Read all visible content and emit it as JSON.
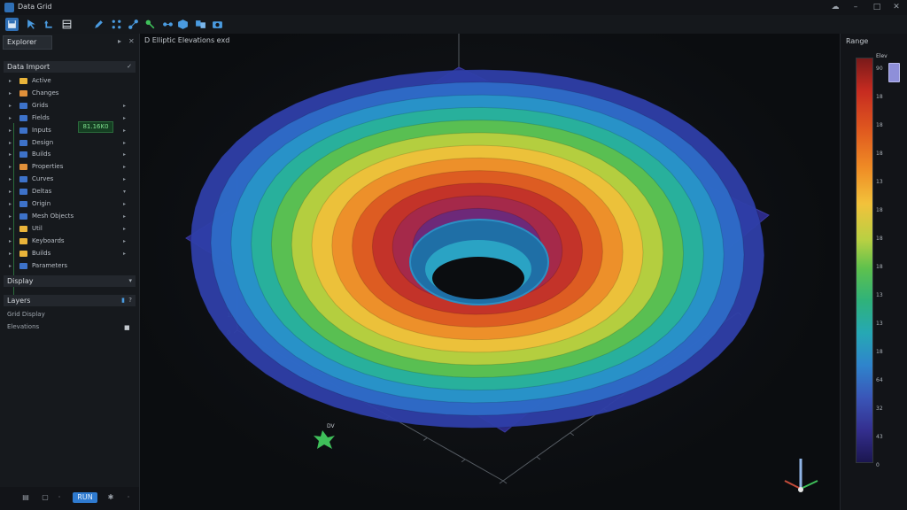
{
  "window": {
    "title": "Data Grid"
  },
  "toolbar": {
    "icons": [
      "save-icon",
      "cursor-icon",
      "undo-icon",
      "layers-icon",
      "pen-icon",
      "grid-icon",
      "magic-icon",
      "node-icon",
      "cube-icon",
      "compare-icon",
      "camera-icon"
    ]
  },
  "left": {
    "tab_label": "Explorer",
    "section_import": "Data Import",
    "items": [
      {
        "label": "Active",
        "color": "#e9b43a",
        "arrow": ""
      },
      {
        "label": "Changes",
        "color": "#e0903a",
        "arrow": ""
      },
      {
        "label": "Grids",
        "color": "#3d72c9",
        "arrow": "▸"
      },
      {
        "label": "Fields",
        "color": "#3d72c9",
        "arrow": "▸"
      },
      {
        "label": "Inputs",
        "color": "#3d72c9",
        "arrow": "▸"
      },
      {
        "label": "Design",
        "color": "#3d72c9",
        "arrow": "▸"
      },
      {
        "label": "Builds",
        "color": "#3d72c9",
        "arrow": "▸"
      },
      {
        "label": "Properties",
        "color": "#e0903a",
        "arrow": "▸"
      },
      {
        "label": "Curves",
        "color": "#3d72c9",
        "arrow": "▸"
      },
      {
        "label": "Deltas",
        "color": "#3d72c9",
        "arrow": "▾"
      },
      {
        "label": "Origin",
        "color": "#3d72c9",
        "arrow": "▸"
      },
      {
        "label": "Mesh Objects",
        "color": "#3d72c9",
        "arrow": "▸"
      },
      {
        "label": "Util",
        "color": "#e9b43a",
        "arrow": "▸"
      },
      {
        "label": "Keyboards",
        "color": "#e9b43a",
        "arrow": "▸"
      },
      {
        "label": "Builds",
        "color": "#e9b43a",
        "arrow": "▸"
      },
      {
        "label": "Parameters",
        "color": "#3d72c9",
        "arrow": ""
      }
    ],
    "value_badge": "81.16K0",
    "section_display": "Display",
    "section_layers": "Layers",
    "prop_rows": [
      "Grid Display",
      "Elevations"
    ],
    "bottom_buttons": [
      "list-icon",
      "file-icon",
      "run",
      "pin-icon"
    ],
    "run_label": "RUN"
  },
  "viewport": {
    "title": "D Elliptic Elevations exd",
    "axis_labels": [
      "10",
      "0",
      "10",
      "0"
    ],
    "marker_label": "DV"
  },
  "legend": {
    "title": "Range",
    "top_label": "Elev",
    "ticks": [
      "90",
      "18",
      "18",
      "18",
      "13",
      "18",
      "18",
      "18",
      "13",
      "13",
      "18",
      "64",
      "32",
      "43",
      "0"
    ]
  },
  "colors": {
    "accent": "#2f7bd0",
    "scale": [
      "#1b1650",
      "#342f8f",
      "#3a56b8",
      "#2f84cc",
      "#26a8b4",
      "#2fb27a",
      "#5ec14d",
      "#b8d043",
      "#f2c23b",
      "#ef8b25",
      "#e05a1f",
      "#c62b20",
      "#7a1a1a"
    ]
  },
  "surface": {
    "rings": 12,
    "inner_radius_fraction": 0.3
  }
}
